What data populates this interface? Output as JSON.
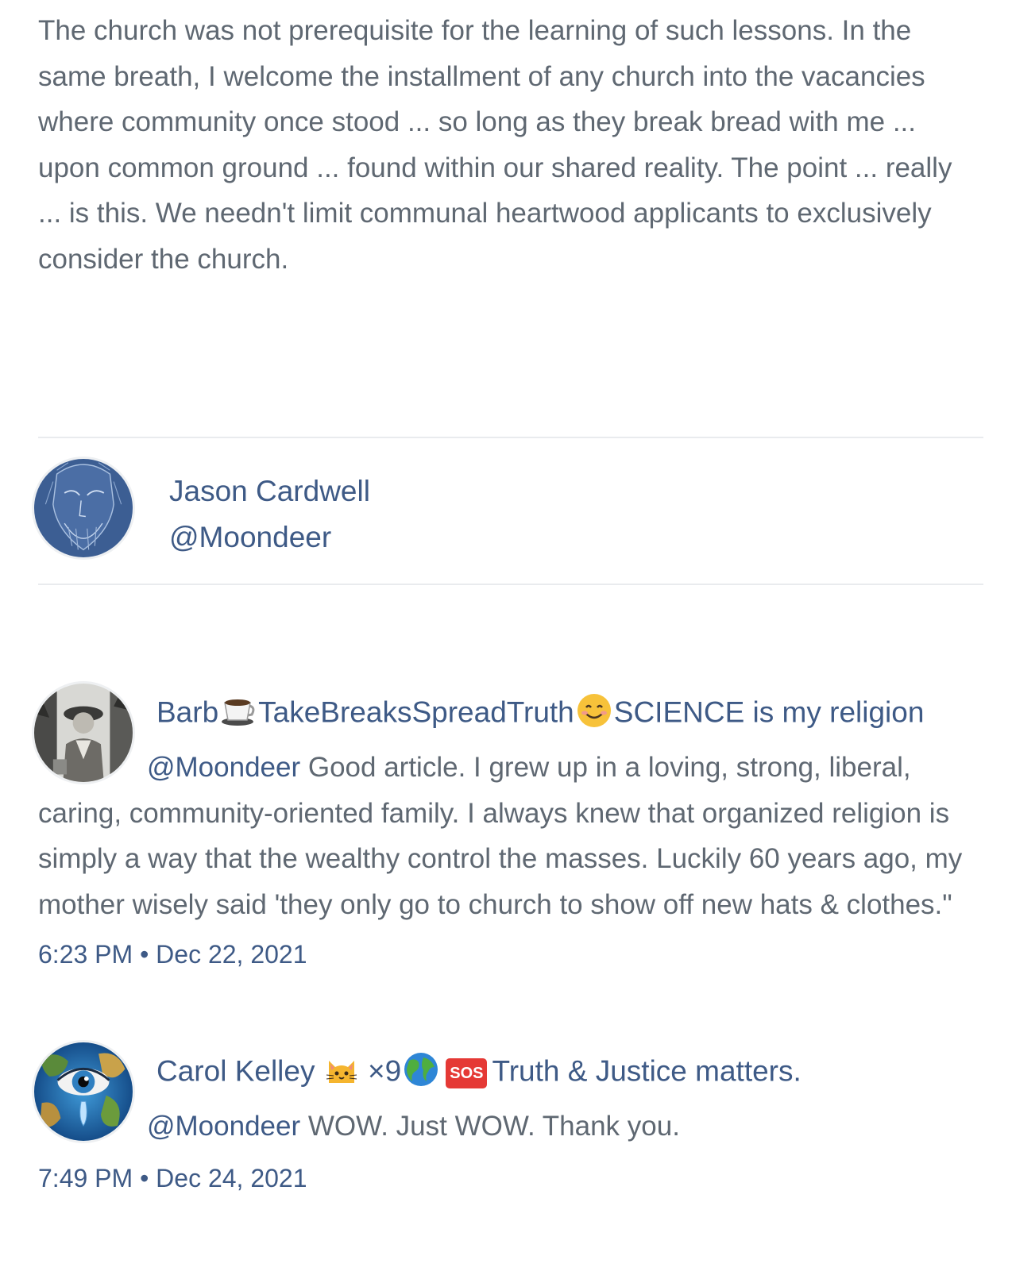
{
  "article": {
    "text": "The church was not prerequisite for the learning of such lessons. In the same breath, I welcome the installment of any church into the vacancies where community once stood ... so long as they break bread with me ... upon common ground ... found within our shared reality. The point ... really ... is this. We needn't limit communal heartwood applicants to exclusively consider the church."
  },
  "author": {
    "name": "Jason Cardwell",
    "handle": "@Moondeer"
  },
  "comments": [
    {
      "name_part1": "Barb",
      "name_part2": "TakeBreaksSpreadTruth",
      "name_part3": "SCIENCE is my religion",
      "mention": "@Moondeer",
      "text": " Good article. I grew up in a loving, strong, liberal, caring, community-oriented family. I always knew that organized religion is simply a way that the wealthy control the masses. Luckily 60 years ago, my mother wisely said 'they only go to church to show off new hats & clothes.\"",
      "time": "6:23 PM",
      "separator": "•",
      "date": "Dec 22, 2021"
    },
    {
      "name_part1": "Carol Kelley",
      "name_part2": "×9",
      "sos": "SOS",
      "name_part3": "Truth & Justice matters.",
      "mention": "@Moondeer",
      "text": " WOW. Just WOW. Thank you.",
      "time": "7:49 PM",
      "separator": "•",
      "date": "Dec 24, 2021"
    }
  ],
  "icons": {
    "author_avatar": "sketched-face-avatar",
    "barb_avatar": "vintage-photo-avatar",
    "carol_avatar": "earth-eye-avatar",
    "coffee": "coffee-cup-icon",
    "smile": "smiling-face-icon",
    "cat": "cat-face-icon",
    "globe": "globe-icon"
  },
  "colors": {
    "link": "#3e5a86",
    "body_text": "#5f6872",
    "divider": "#e9ebee"
  }
}
